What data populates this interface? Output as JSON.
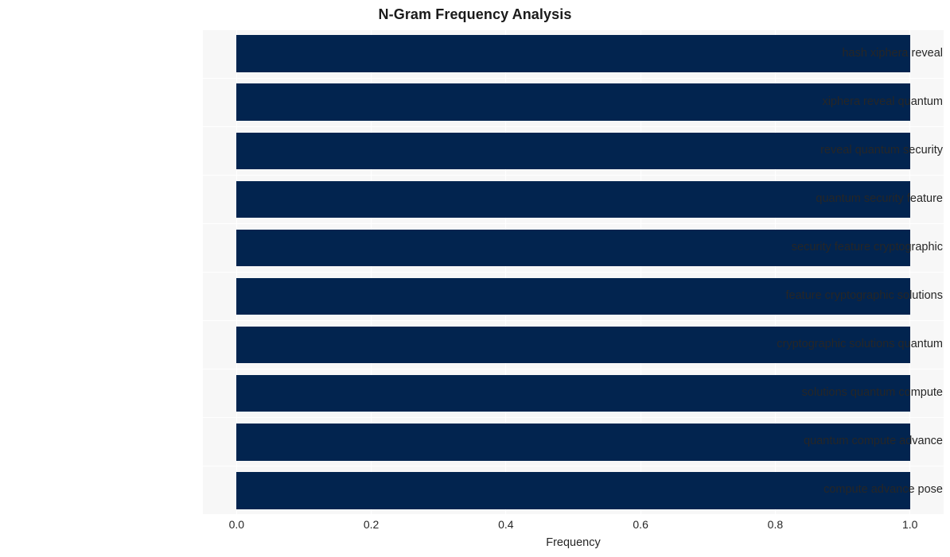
{
  "chart_data": {
    "type": "bar",
    "orientation": "horizontal",
    "title": "N-Gram Frequency Analysis",
    "xlabel": "Frequency",
    "ylabel": "",
    "categories": [
      "hash xiphera reveal",
      "xiphera reveal quantum",
      "reveal quantum security",
      "quantum security feature",
      "security feature cryptographic",
      "feature cryptographic solutions",
      "cryptographic solutions quantum",
      "solutions quantum compute",
      "quantum compute advance",
      "compute advance pose"
    ],
    "values": [
      1.0,
      1.0,
      1.0,
      1.0,
      1.0,
      1.0,
      1.0,
      1.0,
      1.0,
      1.0
    ],
    "xticks": [
      "0.0",
      "0.2",
      "0.4",
      "0.6",
      "0.8",
      "1.0"
    ],
    "xtick_values": [
      0.0,
      0.2,
      0.4,
      0.6,
      0.8,
      1.0
    ],
    "xlim": [
      -0.05,
      1.05
    ],
    "grid": true,
    "legend": null,
    "bar_color": "#02244f",
    "plot_background": "#f7f7f7",
    "grid_color": "#ffffff",
    "figure_background": "#ffffff",
    "text_color": "#262626"
  }
}
